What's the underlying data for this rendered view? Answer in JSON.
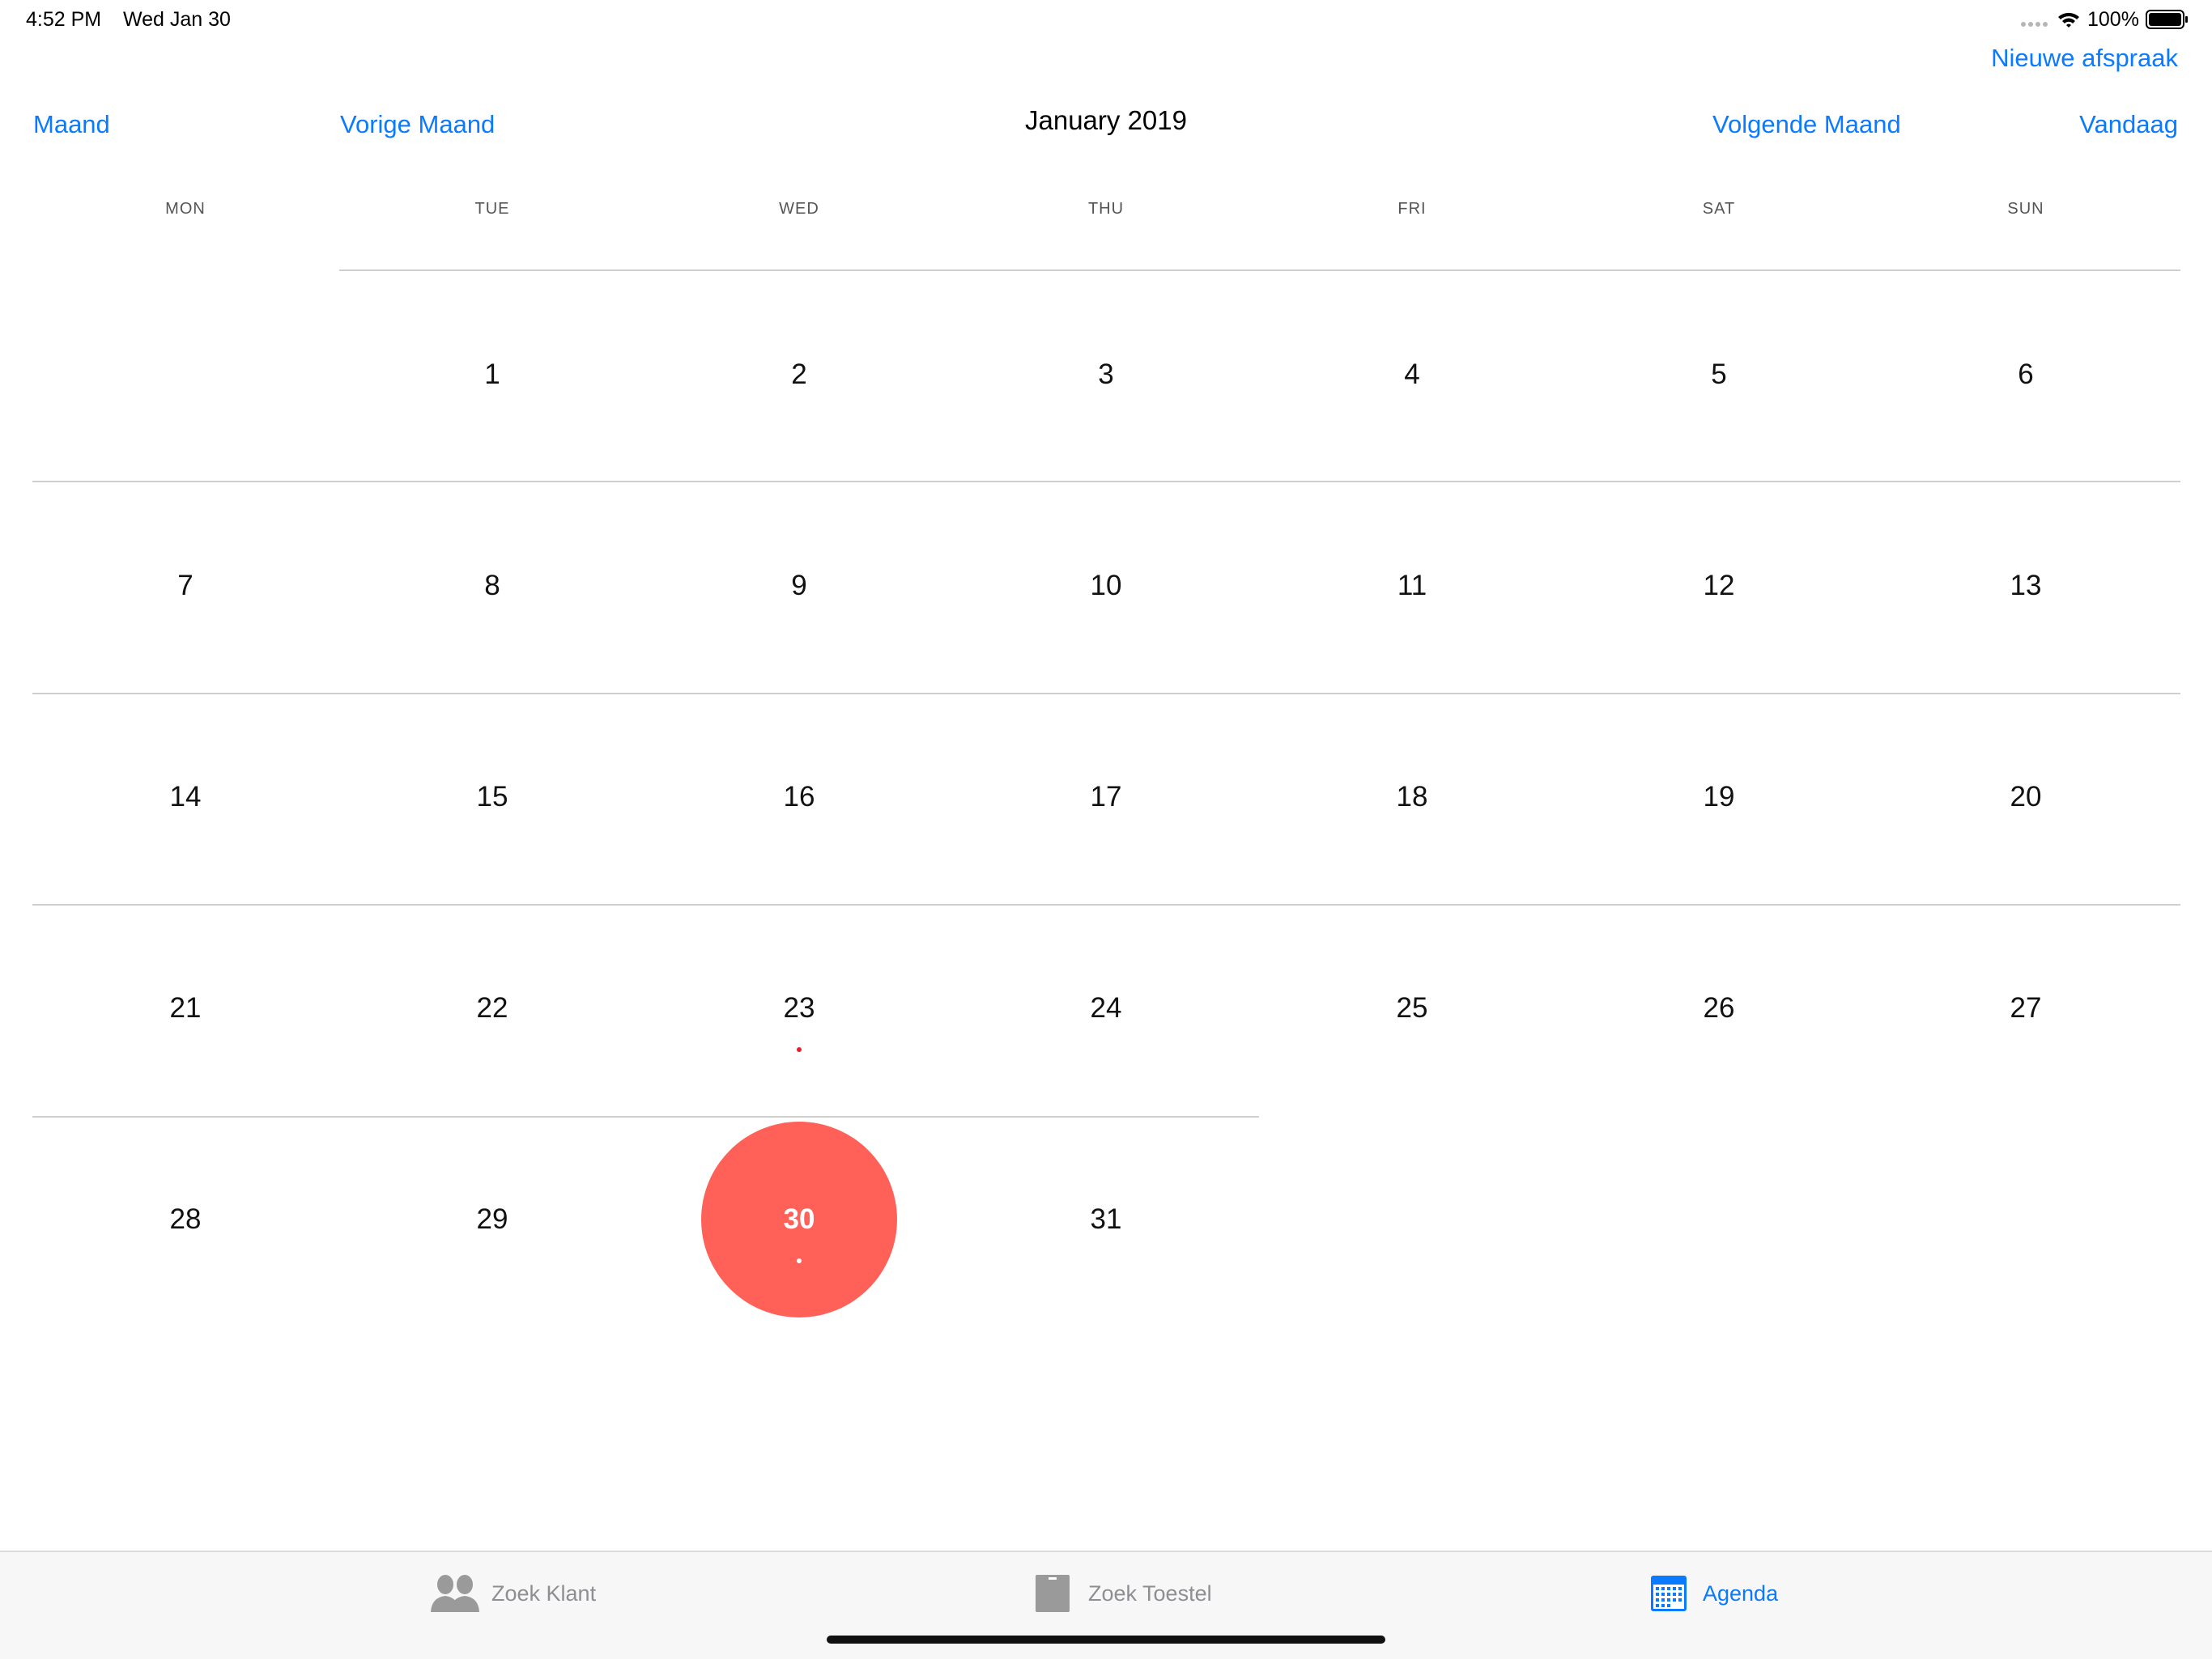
{
  "status_bar": {
    "time": "4:52 PM",
    "date": "Wed Jan 30",
    "battery_percent": "100%",
    "icons": [
      "cellular-dots-icon",
      "wifi-icon",
      "battery-icon"
    ]
  },
  "toolbar": {
    "new_appointment": "Nieuwe afspraak",
    "view_mode": "Maand",
    "previous_month": "Vorige Maand",
    "month_title": "January 2019",
    "next_month": "Volgende Maand",
    "today": "Vandaag"
  },
  "weekdays": [
    "MON",
    "TUE",
    "WED",
    "THU",
    "FRI",
    "SAT",
    "SUN"
  ],
  "calendar": {
    "selected_day": "30",
    "days_with_events": [
      "23",
      "30"
    ],
    "weeks": [
      [
        "",
        "1",
        "2",
        "3",
        "4",
        "5",
        "6"
      ],
      [
        "7",
        "8",
        "9",
        "10",
        "11",
        "12",
        "13"
      ],
      [
        "14",
        "15",
        "16",
        "17",
        "18",
        "19",
        "20"
      ],
      [
        "21",
        "22",
        "23",
        "24",
        "25",
        "26",
        "27"
      ],
      [
        "28",
        "29",
        "30",
        "31",
        "",
        "",
        ""
      ]
    ]
  },
  "tab_bar": {
    "tabs": [
      {
        "label": "Zoek Klant",
        "icon": "people-icon",
        "active": false
      },
      {
        "label": "Zoek Toestel",
        "icon": "device-icon",
        "active": false
      },
      {
        "label": "Agenda",
        "icon": "calendar-icon",
        "active": true
      }
    ]
  },
  "colors": {
    "accent": "#0a7aff",
    "today_circle": "#ff6159",
    "event_dot": "#e8202a",
    "gridline": "#cfcfcf"
  }
}
